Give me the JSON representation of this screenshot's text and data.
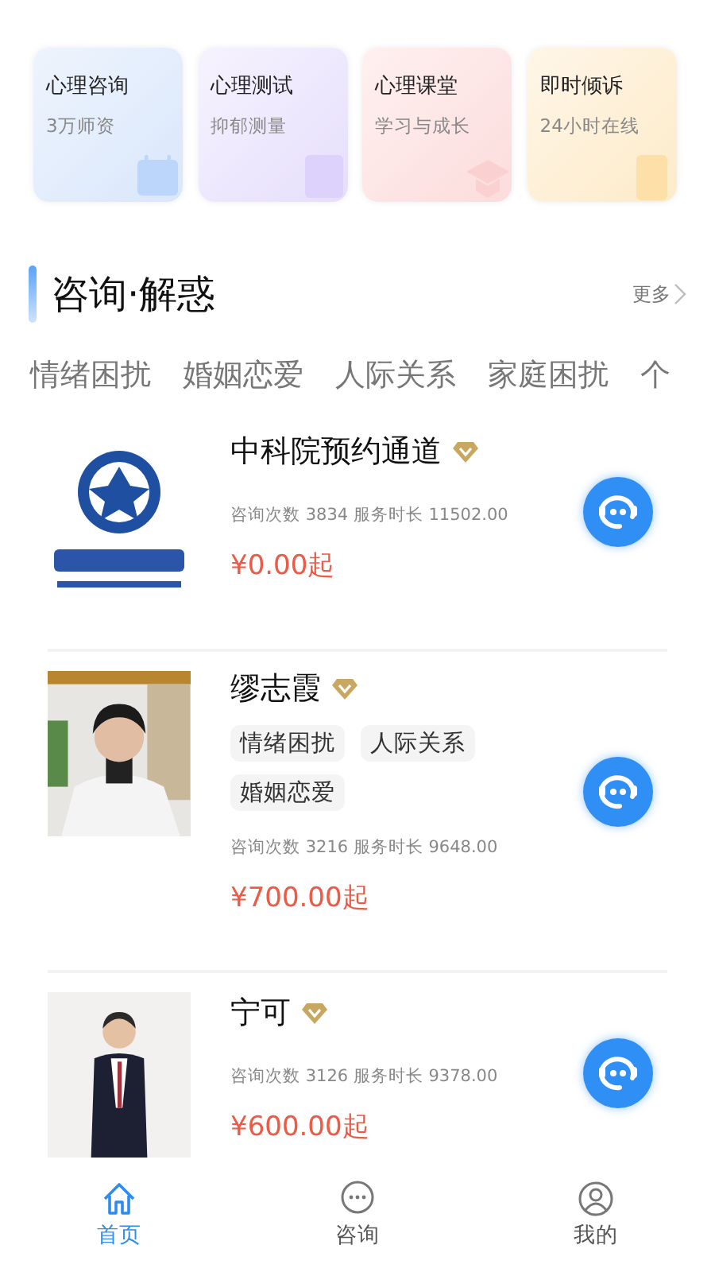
{
  "quick_entries": [
    {
      "title": "心理咨询",
      "subtitle": "3万师资",
      "kind": "calendar"
    },
    {
      "title": "心理测试",
      "subtitle": "抑郁测量",
      "kind": "document"
    },
    {
      "title": "心理课堂",
      "subtitle": "学习与成长",
      "kind": "cap"
    },
    {
      "title": "即时倾诉",
      "subtitle": "24小时在线",
      "kind": "phone"
    }
  ],
  "section": {
    "title": "咨询·解惑",
    "more": "更多"
  },
  "categories": [
    "情绪困扰",
    "婚姻恋爱",
    "人际关系",
    "家庭困扰",
    "个"
  ],
  "counselors": [
    {
      "name": "中科院预约通道",
      "stats": "咨询次数 3834 服务时长 11502.00",
      "price": "¥0.00起"
    },
    {
      "name": "缪志霞",
      "tags": [
        "情绪困扰",
        "人际关系",
        "婚姻恋爱"
      ],
      "stats": "咨询次数 3216 服务时长 9648.00",
      "price": "¥700.00起"
    },
    {
      "name": "宁可",
      "stats": "咨询次数 3126 服务时长 9378.00",
      "price": "¥600.00起"
    }
  ],
  "bottom_nav": [
    {
      "label": "首页",
      "kind": "home",
      "selected": true
    },
    {
      "label": "咨询",
      "kind": "chat",
      "selected": false
    },
    {
      "label": "我的",
      "kind": "user",
      "selected": false
    }
  ]
}
